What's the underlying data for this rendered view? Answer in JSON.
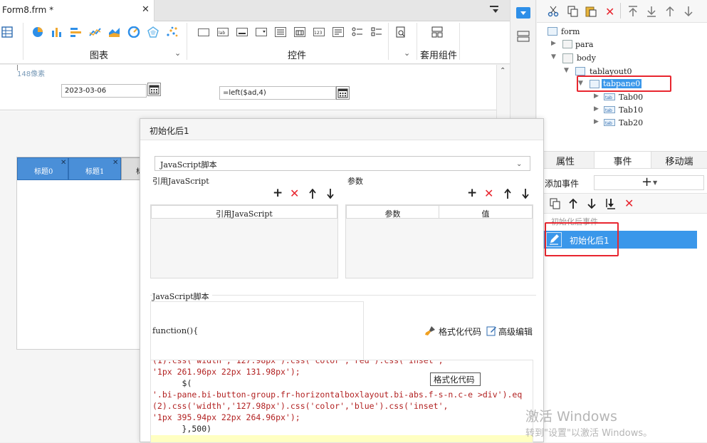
{
  "file_tab": {
    "title": "Form8.frm *",
    "close": "✕"
  },
  "ribbon": {
    "group_chart": "图表",
    "group_controls": "控件",
    "group_components": "套用组件",
    "caret": "⌄"
  },
  "canvas": {
    "pixel_note": "148像素",
    "date_value": "2023-03-06",
    "formula_value": "=left($ad,4)",
    "tabs": [
      "标题0",
      "标题1",
      "标"
    ]
  },
  "tree": {
    "nodes": [
      {
        "label": "form"
      },
      {
        "label": "para"
      },
      {
        "label": "body"
      },
      {
        "label": "tablayout0"
      },
      {
        "label": "tabpane0"
      },
      {
        "label": "Tab00"
      },
      {
        "label": "Tab10"
      },
      {
        "label": "Tab20"
      }
    ],
    "icon_tag": "tab"
  },
  "right_tabs": {
    "props": "属性",
    "events": "事件",
    "mobile": "移动端"
  },
  "events": {
    "add_label": "添加事件",
    "add_symbol": "+",
    "section_title": "初始化后事件",
    "selected_item": "初始化后1"
  },
  "dialog": {
    "title": "初始化后1",
    "type_select": "JavaScript脚本",
    "ref_js_title": "引用JavaScript",
    "params_title": "参数",
    "ref_js_column": "引用JavaScript",
    "param_columns": [
      "参数",
      "值"
    ],
    "script_title": "JavaScript脚本",
    "function_header": "function(){",
    "format_code": "格式化代码",
    "advanced_edit": "高级编辑",
    "tooltip": "格式化代码",
    "code_lines": [
      "(1).css('width','127.98px').css('color','red').css('inset',",
      "'1px 261.96px 22px 131.98px');",
      "      $(",
      "'.bi-pane.bi-button-group.fr-horizontalboxlayout.bi-abs.f-s-n.c-e >div').eq",
      "(2).css('width','127.98px').css('color','blue').css('inset',",
      "'1px 395.94px 22px 264.96px');",
      "      },500)"
    ]
  },
  "watermark": {
    "line1": "激活 Windows",
    "line2": "转到\"设置\"以激活 Windows。"
  },
  "colors": {
    "accent": "#2e8fe8",
    "highlight_red": "#e8262f",
    "selected_row": "#3a97ea",
    "code_red": "#b22222",
    "tab_blue": "#4a8fd8"
  }
}
